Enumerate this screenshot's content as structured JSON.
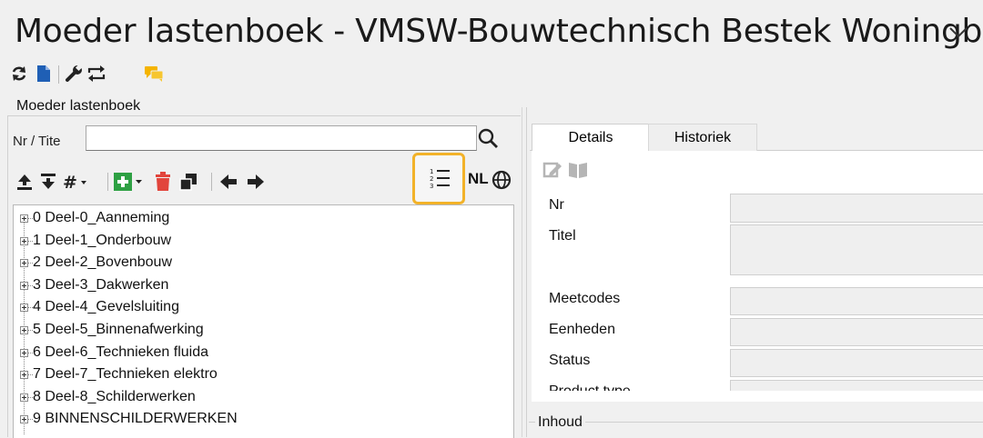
{
  "window": {
    "title": "Moeder lastenboek - VMSW-Bouwtechnisch Bestek Woningb…"
  },
  "toolbar": {
    "icons": [
      "refresh-icon",
      "document-icon",
      "wrench-icon",
      "swap-icon",
      "chat-icon"
    ]
  },
  "left": {
    "group_label": "Moeder lastenboek",
    "search_label": "Nr / Tite",
    "search_value": "",
    "language": "NL",
    "tree": [
      "0 Deel-0_Aanneming",
      "1 Deel-1_Onderbouw",
      "2 Deel-2_Bovenbouw",
      "3 Deel-3_Dakwerken",
      "4 Deel-4_Gevelsluiting",
      "5 Deel-5_Binnenafwerking",
      "6 Deel-6_Technieken fluida",
      "7 Deel-7_Technieken elektro",
      "8 Deel-8_Schilderwerken",
      "9 BINNENSCHILDERWERKEN"
    ]
  },
  "right": {
    "tabs": [
      "Details",
      "Historiek"
    ],
    "fields": {
      "nr": "Nr",
      "titel": "Titel",
      "meetcodes": "Meetcodes",
      "eenheden": "Eenheden",
      "status": "Status",
      "producttype": "Product type"
    },
    "inhoud_label": "Inhoud"
  },
  "colors": {
    "highlight": "#f2b229",
    "add_green": "#2ea043",
    "delete_red": "#e2453c",
    "doc_blue": "#1f5fb5",
    "chat_yellow": "#f5b400"
  }
}
